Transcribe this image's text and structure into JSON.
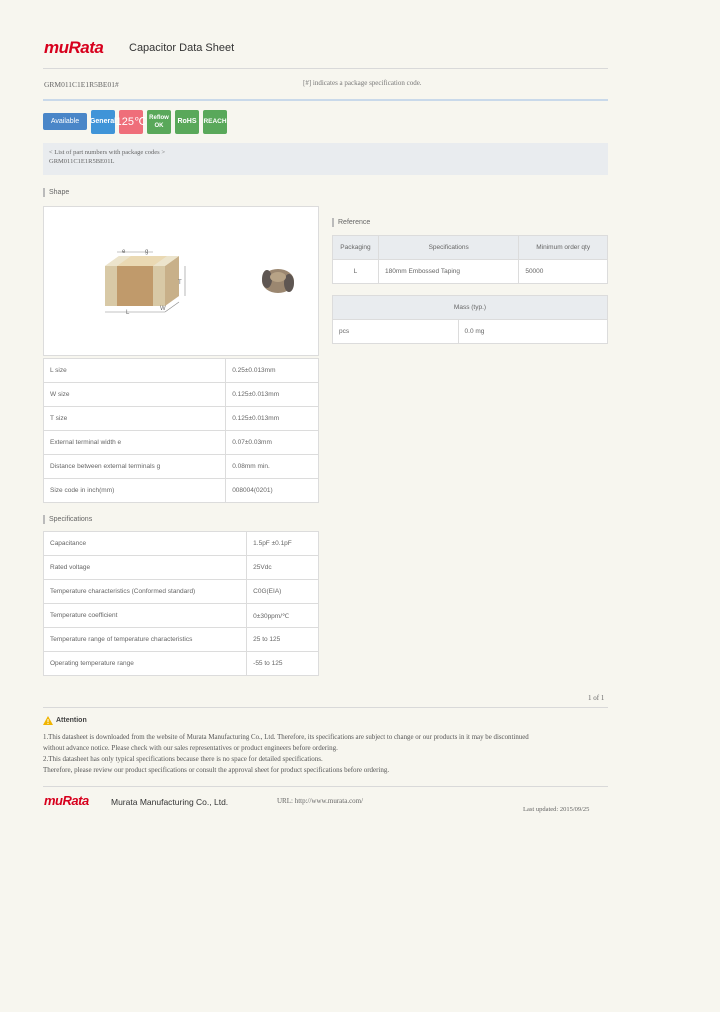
{
  "header": {
    "logo": "muRata",
    "title": "Capacitor Data Sheet",
    "part_number": "GRM011C1E1R5BE01#",
    "note": "[#] indicates a package specification code."
  },
  "badges": [
    {
      "label": "Available",
      "color": "#4a86c8"
    },
    {
      "label": "General",
      "color": "#3f94d8"
    },
    {
      "label": "125℃",
      "color": "#ef6e7a"
    },
    {
      "label": "Reflow OK",
      "color": "#59a85a"
    },
    {
      "label": "RoHS",
      "color": "#59a85a"
    },
    {
      "label": "REACH",
      "color": "#59a85a"
    }
  ],
  "package_box": {
    "line1": "< List of part numbers with package codes >",
    "line2": "GRM011C1E1R5BE01L"
  },
  "shape": {
    "title": "Shape",
    "dims": {
      "e": "e",
      "g": "g",
      "t": "T",
      "l": "L",
      "w": "W"
    },
    "rows": [
      {
        "label": "L size",
        "value": "0.25±0.013mm"
      },
      {
        "label": "W size",
        "value": "0.125±0.013mm"
      },
      {
        "label": "T size",
        "value": "0.125±0.013mm"
      },
      {
        "label": "External terminal width e",
        "value": "0.07±0.03mm"
      },
      {
        "label": "Distance between external terminals g",
        "value": "0.08mm min."
      },
      {
        "label": "Size code in inch(mm)",
        "value": "008004(0201)"
      }
    ]
  },
  "reference": {
    "title": "Reference",
    "headers": [
      "Packaging",
      "Specifications",
      "Minimum order qty"
    ],
    "rows": [
      [
        "L",
        "180mm Embossed Taping",
        "50000"
      ]
    ]
  },
  "mass": {
    "header": "Mass (typ.)",
    "rows": [
      [
        "pcs",
        "0.0 mg"
      ]
    ]
  },
  "specifications": {
    "title": "Specifications",
    "rows": [
      {
        "label": "Capacitance",
        "value": "1.5pF ±0.1pF"
      },
      {
        "label": "Rated voltage",
        "value": "25Vdc"
      },
      {
        "label": "Temperature characteristics (Conformed standard)",
        "value": "C0G(EIA)"
      },
      {
        "label": "Temperature coefficient",
        "value": "0±30ppm/℃"
      },
      {
        "label": "Temperature range of temperature characteristics",
        "value": "25 to 125"
      },
      {
        "label": "Operating temperature range",
        "value": "-55 to 125"
      }
    ]
  },
  "page_number": "1 of 1",
  "attention": {
    "title": "Attention",
    "line1": "1.This datasheet is downloaded from the website of Murata Manufacturing Co., Ltd. Therefore, its specifications are subject to change or our products in it may be discontinued",
    "line2": "without advance notice. Please check with our sales representatives or product engineers before ordering.",
    "line3": "2.This datasheet has only typical specifications because there is no space for detailed specifications.",
    "line4": "Therefore, please review our product specifications or consult the approval sheet for product specifications before ordering."
  },
  "footer": {
    "logo": "muRata",
    "company": "Murata Manufacturing Co., Ltd.",
    "url": "URL: http://www.murata.com/",
    "date": "Last updated: 2015/09/25"
  }
}
